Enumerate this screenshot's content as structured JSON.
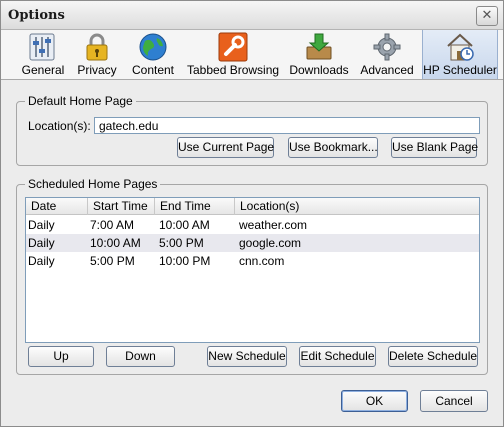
{
  "window": {
    "title": "Options",
    "close_glyph": "✕"
  },
  "toolbar": {
    "tabs": [
      {
        "label": "General",
        "icon": "general-icon"
      },
      {
        "label": "Privacy",
        "icon": "lock-icon"
      },
      {
        "label": "Content",
        "icon": "globe-icon"
      },
      {
        "label": "Tabbed Browsing",
        "icon": "wrench-icon"
      },
      {
        "label": "Downloads",
        "icon": "download-icon"
      },
      {
        "label": "Advanced",
        "icon": "gear-icon"
      },
      {
        "label": "HP Scheduler",
        "icon": "house-icon",
        "selected": true
      }
    ]
  },
  "default_home": {
    "group_label": "Default Home Page",
    "location_label": "Location(s):",
    "location_value": "gatech.edu",
    "use_current_label": "Use Current Page",
    "use_bookmark_label": "Use Bookmark...",
    "use_blank_label": "Use Blank Page"
  },
  "scheduled": {
    "group_label": "Scheduled Home Pages",
    "columns": [
      "Date",
      "Start Time",
      "End Time",
      "Location(s)"
    ],
    "rows": [
      [
        "Daily",
        "7:00 AM",
        "10:00 AM",
        "weather.com"
      ],
      [
        "Daily",
        "10:00 AM",
        "5:00 PM",
        "google.com"
      ],
      [
        "Daily",
        "5:00 PM",
        "10:00 PM",
        "cnn.com"
      ]
    ],
    "up_label": "Up",
    "down_label": "Down",
    "new_label": "New Schedule",
    "edit_label": "Edit Schedule",
    "delete_label": "Delete Schedule"
  },
  "footer": {
    "ok_label": "OK",
    "cancel_label": "Cancel"
  },
  "colors": {
    "accent": "#c8d7ec",
    "selection_row": "#e8e8ee"
  }
}
